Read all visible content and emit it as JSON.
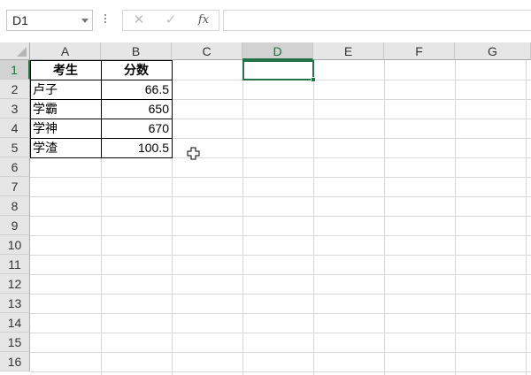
{
  "formula_bar": {
    "name_box": "D1",
    "cancel_icon": "✕",
    "enter_icon": "✓",
    "fx_label": "fx",
    "formula": ""
  },
  "columns": [
    "A",
    "B",
    "C",
    "D",
    "E",
    "F",
    "G"
  ],
  "rows": [
    "1",
    "2",
    "3",
    "4",
    "5",
    "6",
    "7",
    "8",
    "9",
    "10",
    "11",
    "12",
    "13",
    "14",
    "15",
    "16"
  ],
  "selected_cell": "D1",
  "table": {
    "headers": [
      "考生",
      "分数"
    ],
    "rows": [
      {
        "name": "卢子",
        "score": "66.5"
      },
      {
        "name": "学霸",
        "score": "650"
      },
      {
        "name": "学神",
        "score": "670"
      },
      {
        "name": "学渣",
        "score": "100.5"
      }
    ]
  },
  "colors": {
    "selection": "#217346",
    "header_bg": "#e6e6e6",
    "gridline": "#d9d9d9"
  }
}
